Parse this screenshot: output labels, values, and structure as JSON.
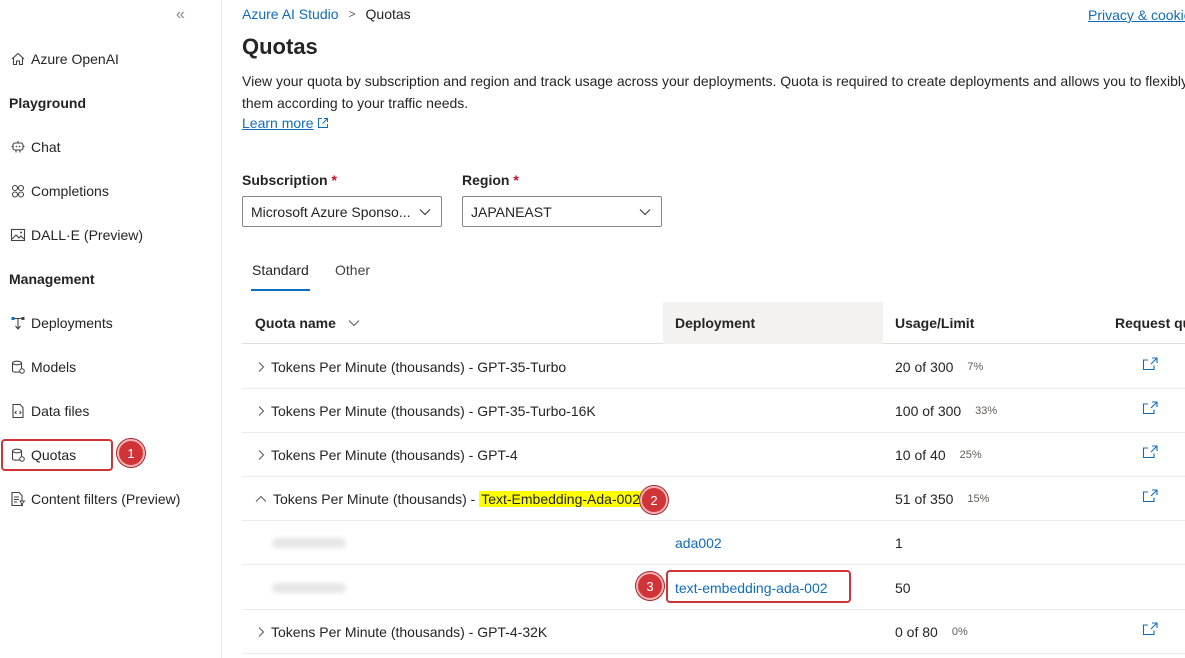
{
  "sidebar": {
    "collapse_icon": "double-chevron-left",
    "items": [
      {
        "label": "Azure OpenAI",
        "icon": "home-icon"
      },
      {
        "label": "Chat",
        "icon": "chat-icon"
      },
      {
        "label": "Completions",
        "icon": "completions-icon"
      },
      {
        "label": "DALL·E (Preview)",
        "icon": "image-icon"
      },
      {
        "label": "Deployments",
        "icon": "deployments-icon"
      },
      {
        "label": "Models",
        "icon": "models-icon"
      },
      {
        "label": "Data files",
        "icon": "data-files-icon"
      },
      {
        "label": "Quotas",
        "icon": "quotas-icon"
      },
      {
        "label": "Content filters (Preview)",
        "icon": "content-filters-icon"
      }
    ],
    "sections": {
      "playground": "Playground",
      "management": "Management"
    }
  },
  "annotations": {
    "badge1": "1",
    "badge2": "2",
    "badge3": "3"
  },
  "breadcrumb": {
    "root": "Azure AI Studio",
    "current": "Quotas"
  },
  "header": {
    "privacy": "Privacy & cookies"
  },
  "page": {
    "title": "Quotas",
    "description_line1": "View your quota by subscription and region and track usage across your deployments. Quota is required to create deployments and allows you to flexibly",
    "description_line2": "them according to your traffic needs.",
    "learn_more": "Learn more"
  },
  "filters": {
    "subscription_label": "Subscription",
    "subscription_value": "Microsoft Azure Sponso...",
    "region_label": "Region",
    "region_value": "JAPANEAST",
    "required_mark": "*"
  },
  "tabs": {
    "standard": "Standard",
    "other": "Other",
    "selected": "Standard"
  },
  "table": {
    "columns": {
      "quota_name": "Quota name",
      "deployment": "Deployment",
      "usage": "Usage/Limit",
      "request": "Request quota"
    },
    "rows": [
      {
        "prefix": "Tokens Per Minute (thousands) - GPT-35-Turbo",
        "usage": "20 of 300",
        "pct": "7%"
      },
      {
        "prefix": "Tokens Per Minute (thousands) - GPT-35-Turbo-16K",
        "usage": "100 of 300",
        "pct": "33%"
      },
      {
        "prefix": "Tokens Per Minute (thousands) - GPT-4",
        "usage": "10 of 40",
        "pct": "25%"
      },
      {
        "prefix": "Tokens Per Minute (thousands) - ",
        "highlight": "Text-Embedding-Ada-002",
        "usage": "51 of 350",
        "pct": "15%"
      },
      {
        "deployment": "ada002",
        "usage": "1"
      },
      {
        "deployment": "text-embedding-ada-002",
        "usage": "50"
      },
      {
        "prefix": "Tokens Per Minute (thousands) - GPT-4-32K",
        "usage": "0 of 80",
        "pct": "0%"
      }
    ]
  },
  "colors": {
    "accent": "#0f6cbd",
    "annotation": "#d13438",
    "highlight": "#ffff00"
  }
}
